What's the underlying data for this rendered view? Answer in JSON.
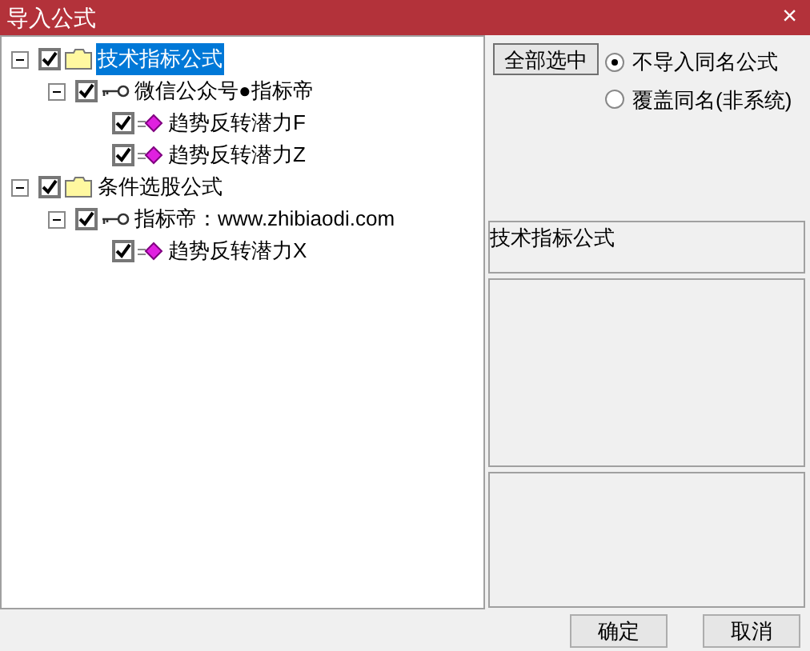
{
  "window": {
    "title": "导入公式",
    "close": "×"
  },
  "tree": [
    {
      "label": "技术指标公式",
      "kind": "folder",
      "checked": true,
      "selected": true,
      "expanded": true,
      "children": [
        {
          "label": "微信公众号●指标帝",
          "kind": "key",
          "checked": true,
          "selected": false,
          "expanded": true,
          "children": [
            {
              "label": "趋势反转潜力F",
              "kind": "formula",
              "checked": true,
              "selected": false
            },
            {
              "label": "趋势反转潜力Z",
              "kind": "formula",
              "checked": true,
              "selected": false
            }
          ]
        }
      ]
    },
    {
      "label": "条件选股公式",
      "kind": "folder",
      "checked": true,
      "selected": false,
      "expanded": true,
      "children": [
        {
          "label": "指标帝：www.zhibiaodi.com",
          "kind": "key",
          "checked": true,
          "selected": false,
          "expanded": true,
          "children": [
            {
              "label": "趋势反转潜力X",
              "kind": "formula",
              "checked": true,
              "selected": false
            }
          ]
        }
      ]
    }
  ],
  "select_all_button": "全部选中",
  "options": [
    {
      "label": "不导入同名公式",
      "selected": true
    },
    {
      "label": "覆盖同名(非系统)",
      "selected": false
    }
  ],
  "info_label": "技术指标公式",
  "buttons": [
    "确定",
    "取消"
  ]
}
